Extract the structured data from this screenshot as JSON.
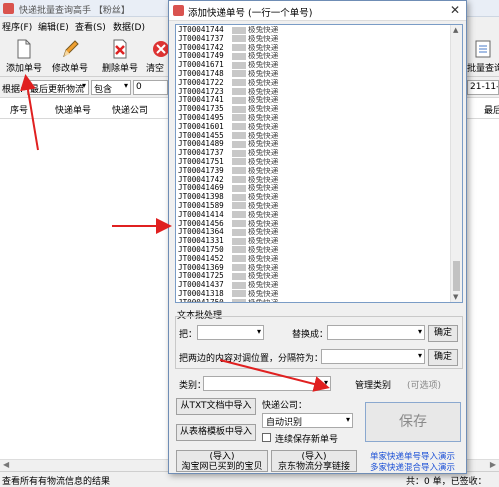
{
  "main_window": {
    "title": "快递批量查询高手 【粉丝】",
    "menu": [
      "程序(F)",
      "编辑(E)",
      "查看(S)",
      "数据(D)"
    ],
    "toolbar": {
      "add": "添加单号",
      "edit": "修改单号",
      "delete": "删除单号",
      "clear": "清空",
      "batch_right": "批量查询"
    },
    "filter": {
      "label": "根据:",
      "field1": "最后更新物流",
      "field2": "包含",
      "field3": "0",
      "date": "21-11-26"
    },
    "columns": [
      "序号",
      "快递单号",
      "快递公司",
      "最后"
    ],
    "status_left": "查看所有有物流信息的结果",
    "status_right": "共：0 单，已签收："
  },
  "dialog": {
    "title": "添加快递单号 (一行一个单号)",
    "list_lines": [
      "JT00041744",
      "JT00041737",
      "JT00041742",
      "JT00041749",
      "JT00041671",
      "JT00041748",
      "JT00041722",
      "JT00041723",
      "JT00041741",
      "JT00041735",
      "JT00041495",
      "JT00041601",
      "JT00041455",
      "JT00041489",
      "JT00041737",
      "JT00041751",
      "JT00041739",
      "JT00041742",
      "JT00041469",
      "JT00041398",
      "JT00041589",
      "JT00041414",
      "JT00041456",
      "JT00041364",
      "JT00041331",
      "JT00041750",
      "JT00041452",
      "JT00041369",
      "JT00041725",
      "JT00041437",
      "JT00041318",
      "JT00041750",
      "JT00041324",
      "JT00041728"
    ],
    "company_text": "极兔快递",
    "text_process": {
      "section_label": "文本批处理",
      "replace_label": "把：",
      "replace_with_label": "替换成：",
      "confirm1": "确定",
      "swap_label": "把两边的内容对调位置，分隔符为：",
      "confirm2": "确定"
    },
    "category_label": "类别：",
    "manage_category": "管理类别",
    "optional": "(可选项)",
    "import_txt": "从TXT文档中导入",
    "courier_label": "快递公司：",
    "courier_value": "自动识别",
    "import_table": "从表格模板中导入",
    "continue_save": "连续保存新单号",
    "taobao_line1": "(导入)",
    "taobao_line2": "淘宝网已买到的宝贝",
    "jd_line1": "(导入)",
    "jd_line2": "京东物流分享链接",
    "save": "保存",
    "link1": "单家快递单号导入演示",
    "link2": "多家快递混合导入演示"
  }
}
